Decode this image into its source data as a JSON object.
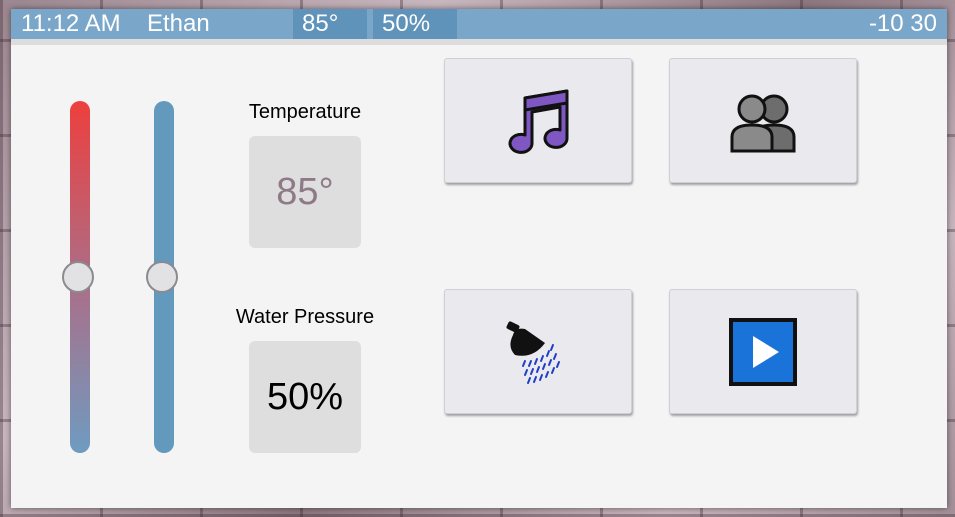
{
  "status_bar": {
    "time": "11:12 AM",
    "user": "Ethan",
    "temperature": "85°",
    "pressure": "50%",
    "right_text": "-10 30"
  },
  "controls": {
    "temperature": {
      "label": "Temperature",
      "value": "85°",
      "slider_level": 0.5
    },
    "water_pressure": {
      "label": "Water Pressure",
      "value": "50%",
      "slider_level": 0.5
    }
  },
  "tiles": [
    {
      "icon": "music-note-icon"
    },
    {
      "icon": "people-icon"
    },
    {
      "icon": "shower-icon"
    },
    {
      "icon": "play-icon"
    }
  ],
  "colors": {
    "status_bar": "#7aa7c9",
    "status_highlight": "#5f93ba",
    "temp_slider_top": "#ee3f3d",
    "pressure_slider": "#6399bd",
    "music_icon": "#7e57c2",
    "play_icon": "#1a73d9"
  }
}
